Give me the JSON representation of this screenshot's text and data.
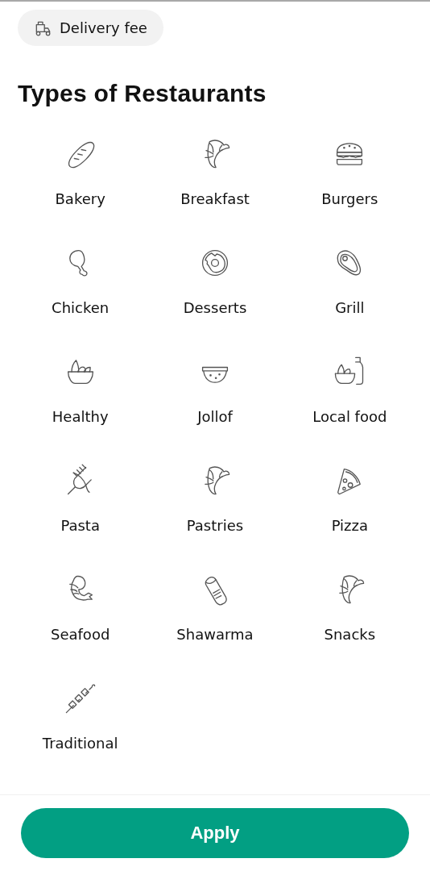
{
  "filter_chip": {
    "label": "Delivery fee"
  },
  "section_title": "Types of Restaurants",
  "categories": [
    {
      "label": "Bakery"
    },
    {
      "label": "Breakfast"
    },
    {
      "label": "Burgers"
    },
    {
      "label": "Chicken"
    },
    {
      "label": "Desserts"
    },
    {
      "label": "Grill"
    },
    {
      "label": "Healthy"
    },
    {
      "label": "Jollof"
    },
    {
      "label": "Local food"
    },
    {
      "label": "Pasta"
    },
    {
      "label": "Pastries"
    },
    {
      "label": "Pizza"
    },
    {
      "label": "Seafood"
    },
    {
      "label": "Shawarma"
    },
    {
      "label": "Snacks"
    },
    {
      "label": "Traditional"
    }
  ],
  "apply_button": "Apply"
}
